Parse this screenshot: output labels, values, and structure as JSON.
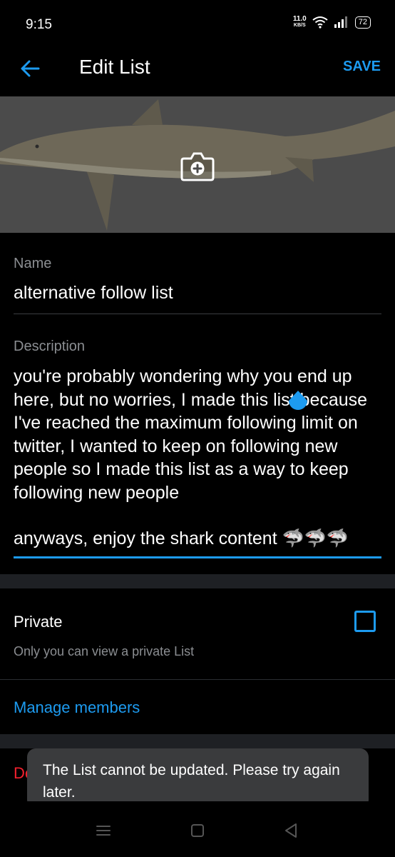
{
  "status_bar": {
    "time": "9:15",
    "net_speed_value": "11.0",
    "net_speed_unit": "KB/S",
    "battery": "72"
  },
  "header": {
    "title": "Edit List",
    "save_label": "SAVE"
  },
  "form": {
    "name_label": "Name",
    "name_value": "alternative follow list",
    "description_label": "Description",
    "description_paragraph_1": "you're probably wondering why you end up here, but no worries, I made this list because I've reached the maximum following limit on twitter, I wanted to keep on following new people so I made this list as a way to keep following new people",
    "description_paragraph_2": "anyways, enjoy the shark content 🦈🦈🦈"
  },
  "private": {
    "label": "Private",
    "subtitle": "Only you can view a private List",
    "checked": false
  },
  "manage_members_label": "Manage members",
  "delete_label_partial": "De",
  "toast": {
    "message": "The List cannot be updated. Please try again later."
  },
  "colors": {
    "accent": "#1d9bf0",
    "danger": "#f4212e",
    "background": "#000000"
  }
}
